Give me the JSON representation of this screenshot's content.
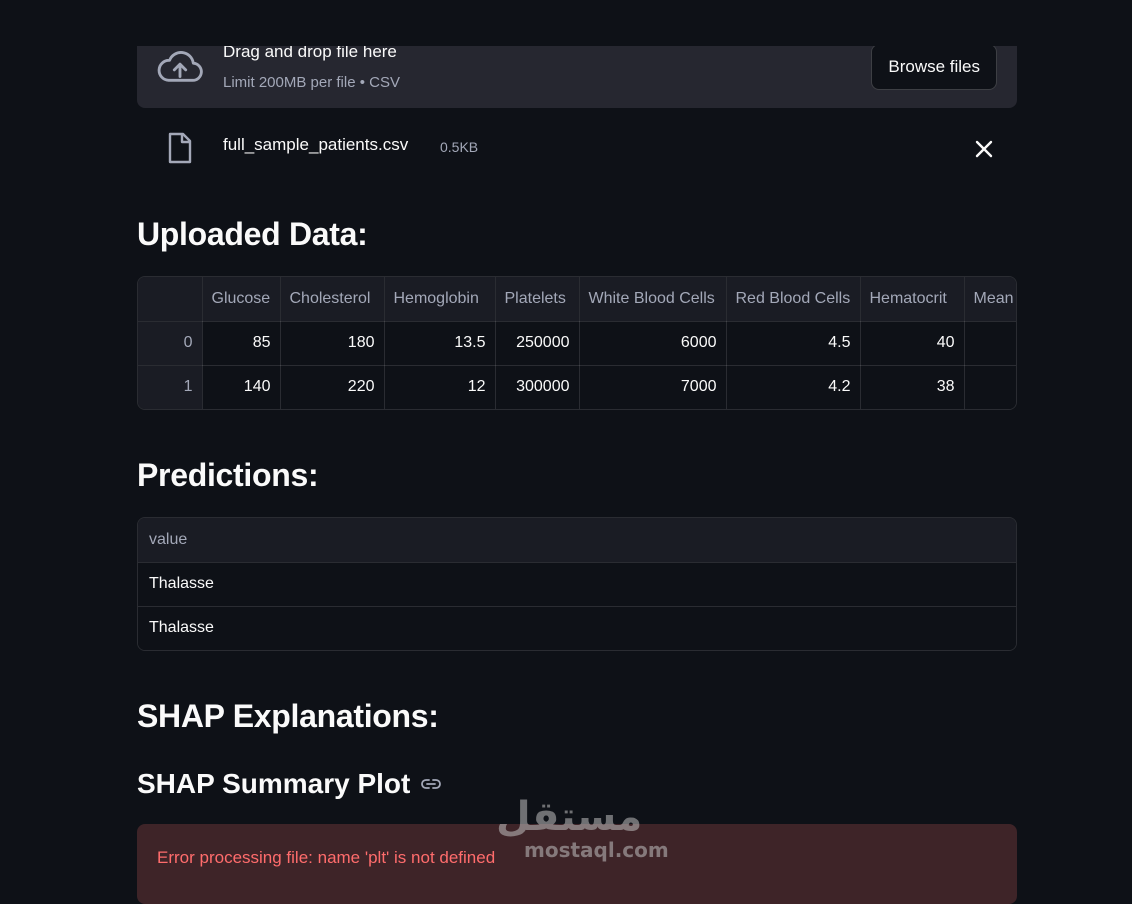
{
  "uploader": {
    "title": "Drag and drop file here",
    "subtitle": "Limit 200MB per file • CSV",
    "browse_label": "Browse files",
    "icon": "cloud-upload-icon"
  },
  "uploaded_file": {
    "name": "full_sample_patients.csv",
    "size": "0.5KB",
    "icon": "file-icon"
  },
  "sections": {
    "uploaded_data": "Uploaded Data:",
    "predictions": "Predictions:",
    "shap": "SHAP Explanations:",
    "shap_summary": "SHAP Summary Plot"
  },
  "uploaded_table": {
    "columns": [
      "",
      "Glucose",
      "Cholesterol",
      "Hemoglobin",
      "Platelets",
      "White Blood Cells",
      "Red Blood Cells",
      "Hematocrit",
      "Mean"
    ],
    "rows": [
      [
        "0",
        "85",
        "180",
        "13.5",
        "250000",
        "6000",
        "4.5",
        "40",
        ""
      ],
      [
        "1",
        "140",
        "220",
        "12",
        "300000",
        "7000",
        "4.2",
        "38",
        ""
      ]
    ]
  },
  "predictions_table": {
    "columns": [
      "value"
    ],
    "rows": [
      [
        "Thalasse"
      ],
      [
        "Thalasse"
      ]
    ]
  },
  "error": {
    "message": "Error processing file: name 'plt' is not defined"
  },
  "watermark": {
    "word": "مستقل",
    "url": "mostaql.com"
  },
  "colors": {
    "background": "#0e1117",
    "panel": "#262730",
    "error_bg": "#3e2428",
    "error_text": "#ff6c6c",
    "muted": "#a3a8b8"
  }
}
